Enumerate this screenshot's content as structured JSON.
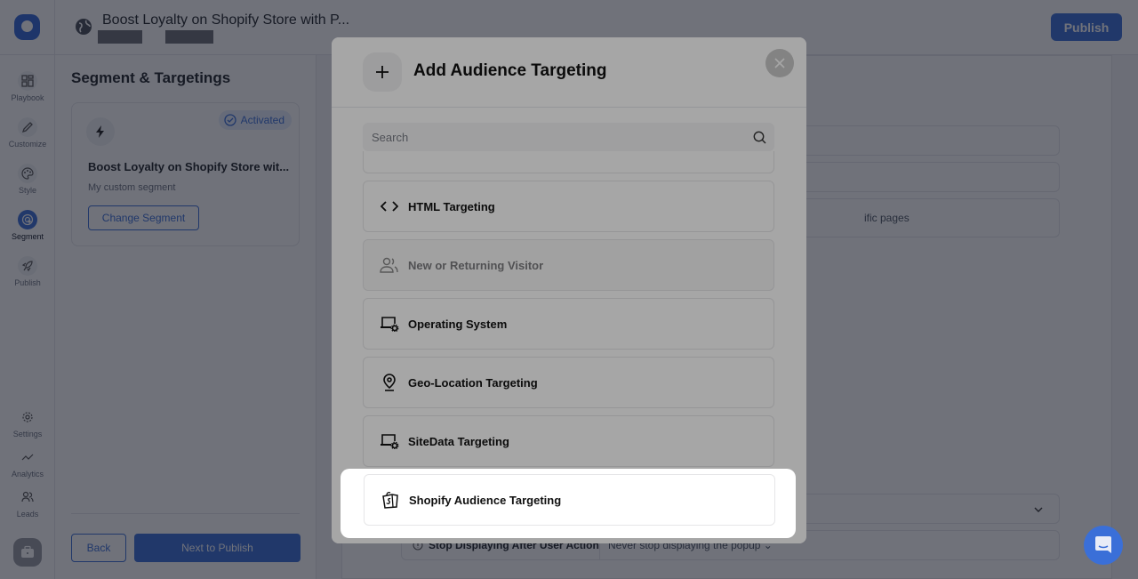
{
  "app": {
    "page_title": "Boost Loyalty on Shopify Store with P...",
    "publish_label": "Publish",
    "brand_color": "#3a6fd8"
  },
  "sidenav": {
    "items": [
      {
        "label": "Playbook",
        "icon": "grid-icon"
      },
      {
        "label": "Customize",
        "icon": "pencil-icon"
      },
      {
        "label": "Style",
        "icon": "palette-icon"
      },
      {
        "label": "Segment",
        "icon": "target-cursor-icon",
        "active": true
      },
      {
        "label": "Publish",
        "icon": "rocket-icon"
      },
      {
        "label": "Settings",
        "icon": "gear-icon"
      },
      {
        "label": "Analytics",
        "icon": "trend-icon"
      },
      {
        "label": "Leads",
        "icon": "users-icon"
      }
    ]
  },
  "left_panel": {
    "title": "Segment & Targetings",
    "segment": {
      "status": "Activated",
      "name": "Boost Loyalty on Shopify Store wit...",
      "description": "My custom segment",
      "change_label": "Change Segment"
    },
    "back_label": "Back",
    "next_label": "Next to Publish"
  },
  "main": {
    "rows": [
      {
        "text": ""
      },
      {
        "text": ""
      },
      {
        "text": "ific pages"
      }
    ],
    "stop_row": {
      "label": "Stop Displaying After User Action",
      "value": "Never stop displaying the popup"
    }
  },
  "modal": {
    "title": "Add Audience Targeting",
    "search_placeholder": "Search",
    "search_value": "",
    "options": [
      {
        "label": "HTML Targeting",
        "icon": "code-brackets-icon",
        "disabled": false
      },
      {
        "label": "New or Returning Visitor",
        "icon": "users-return-icon",
        "disabled": true
      },
      {
        "label": "Operating System",
        "icon": "laptop-gear-icon",
        "disabled": false
      },
      {
        "label": "Geo-Location Targeting",
        "icon": "map-pin-icon",
        "disabled": false
      },
      {
        "label": "SiteData Targeting",
        "icon": "laptop-gear-icon",
        "disabled": false
      },
      {
        "label": "Shopify Audience Targeting",
        "icon": "shopify-bag-icon",
        "disabled": false,
        "highlighted": true
      }
    ]
  }
}
